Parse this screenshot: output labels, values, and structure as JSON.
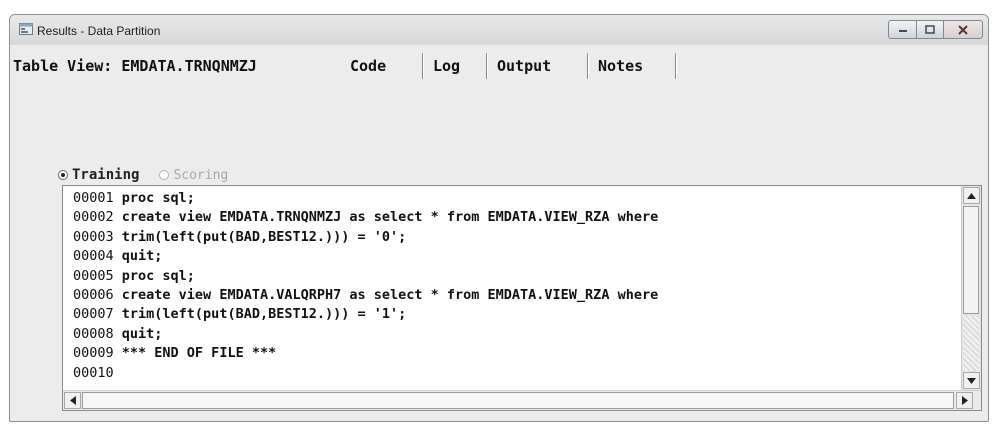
{
  "window": {
    "title": "Results - Data Partition"
  },
  "tabs": {
    "table_view": "Table View: EMDATA.TRNQNMZJ",
    "code": "Code",
    "log": "Log",
    "output": "Output",
    "notes": "Notes"
  },
  "options": {
    "training_label": "Training",
    "scoring_label": "Scoring",
    "selected": "Training"
  },
  "code": {
    "lines": [
      {
        "num": "00001",
        "text": "proc sql;"
      },
      {
        "num": "00002",
        "text": "create view EMDATA.TRNQNMZJ as select * from EMDATA.VIEW_RZA where"
      },
      {
        "num": "00003",
        "text": "trim(left(put(BAD,BEST12.))) = '0';"
      },
      {
        "num": "00004",
        "text": "quit;"
      },
      {
        "num": "00005",
        "text": "proc sql;"
      },
      {
        "num": "00006",
        "text": "create view EMDATA.VALQRPH7 as select * from EMDATA.VIEW_RZA where"
      },
      {
        "num": "00007",
        "text": "trim(left(put(BAD,BEST12.))) = '1';"
      },
      {
        "num": "00008",
        "text": "quit;"
      },
      {
        "num": "00009",
        "text": "*** END OF FILE ***"
      },
      {
        "num": "00010",
        "text": ""
      }
    ]
  },
  "colors": {
    "window_bg": "#ececec",
    "code_bg": "#ffffff",
    "text": "#111111"
  },
  "icons": {
    "app": "results-window-icon",
    "minimize": "minimize-icon",
    "maximize": "maximize-icon",
    "close": "close-icon",
    "scroll_up": "arrow-up-icon",
    "scroll_down": "arrow-down-icon",
    "scroll_left": "arrow-left-icon",
    "scroll_right": "arrow-right-icon"
  }
}
